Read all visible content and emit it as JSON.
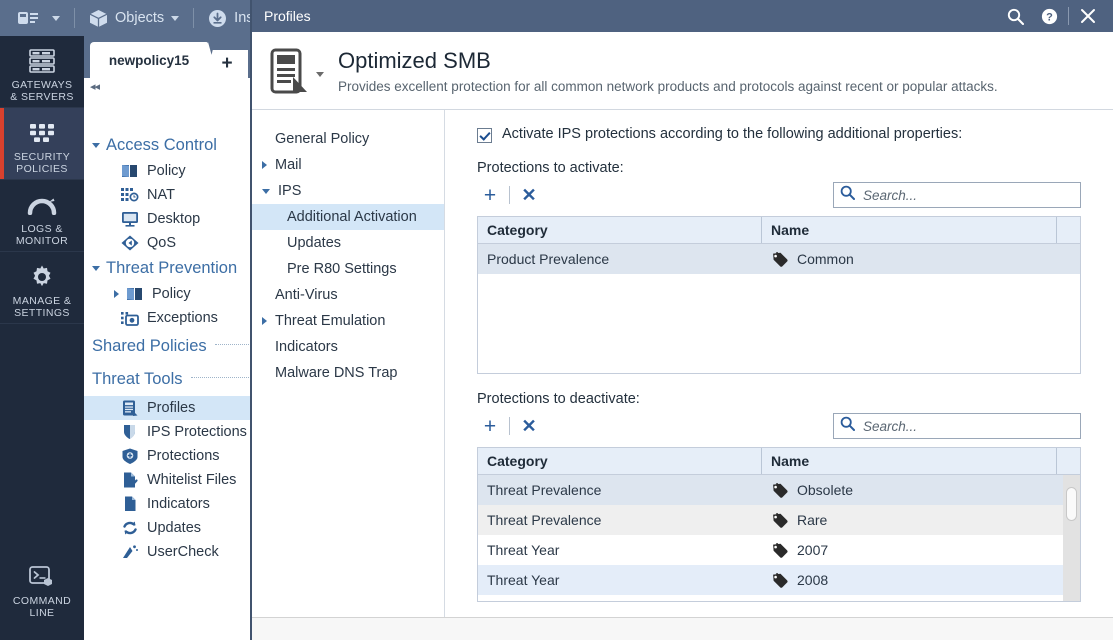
{
  "app": {
    "toolbar": {
      "menu_icon": "app-menu-icon",
      "items": [
        {
          "label": "Objects",
          "icon": "cube-icon",
          "has_caret": true
        },
        {
          "label": "Insta",
          "icon": "install-policy-icon",
          "has_caret": false
        }
      ]
    },
    "rail": {
      "items": [
        {
          "label": "GATEWAYS\n& SERVERS",
          "line1": "GATEWAYS",
          "line2": "& SERVERS",
          "icon": "servers-icon",
          "selected": false
        },
        {
          "label": "SECURITY POLICIES",
          "line1": "SECURITY",
          "line2": "POLICIES",
          "icon": "grid-blocks-icon",
          "selected": true
        },
        {
          "label": "LOGS & MONITOR",
          "line1": "LOGS &",
          "line2": "MONITOR",
          "icon": "gauge-icon",
          "selected": false
        },
        {
          "label": "MANAGE & SETTINGS",
          "line1": "MANAGE &",
          "line2": "SETTINGS",
          "icon": "gear-icon",
          "selected": false
        }
      ],
      "bottom": {
        "line1": "COMMAND",
        "line2": "LINE",
        "icon": "command-line-icon"
      }
    },
    "tab": {
      "label": "newpolicy15",
      "add_label": "+",
      "collapse_label": "◂◂"
    },
    "tree": {
      "groups": [
        {
          "label": "Access Control",
          "expanded": true,
          "items": [
            {
              "label": "Policy",
              "icon": "policy-book-icon",
              "expandable": false
            },
            {
              "label": "NAT",
              "icon": "nat-icon",
              "expandable": false
            },
            {
              "label": "Desktop",
              "icon": "desktop-icon",
              "expandable": false
            },
            {
              "label": "QoS",
              "icon": "qos-icon",
              "expandable": false
            }
          ]
        },
        {
          "label": "Threat Prevention",
          "expanded": true,
          "items": [
            {
              "label": "Policy",
              "icon": "policy-book-icon",
              "expandable": true
            },
            {
              "label": "Exceptions",
              "icon": "exceptions-icon",
              "expandable": false
            }
          ]
        }
      ],
      "shared_policies_label": "Shared Policies",
      "threat_tools_label": "Threat Tools",
      "threat_tools": [
        {
          "label": "Profiles",
          "icon": "profiles-icon",
          "selected": true
        },
        {
          "label": "IPS Protections",
          "icon": "ips-shield-icon",
          "selected": false
        },
        {
          "label": "Protections",
          "icon": "protections-badge-icon",
          "selected": false
        },
        {
          "label": "Whitelist Files",
          "icon": "whitelist-files-icon",
          "selected": false
        },
        {
          "label": "Indicators",
          "icon": "indicators-doc-icon",
          "selected": false
        },
        {
          "label": "Updates",
          "icon": "updates-refresh-icon",
          "selected": false
        },
        {
          "label": "UserCheck",
          "icon": "usercheck-icon",
          "selected": false
        }
      ]
    }
  },
  "dialog": {
    "window_title": "Profiles",
    "title_actions": [
      {
        "name": "search-icon",
        "label": "⌕"
      },
      {
        "name": "help-icon",
        "label": "?"
      },
      {
        "name": "close-icon",
        "label": "✕"
      }
    ],
    "header": {
      "icon": "profile-document-icon",
      "title": "Optimized SMB",
      "subtitle": "Provides excellent protection for all common network products and protocols against recent or popular attacks."
    },
    "nav": [
      {
        "label": "General Policy",
        "level": 0,
        "toggle": "none",
        "selected": false
      },
      {
        "label": "Mail",
        "level": 0,
        "toggle": "right",
        "selected": false
      },
      {
        "label": "IPS",
        "level": 0,
        "toggle": "down",
        "selected": false
      },
      {
        "label": "Additional Activation",
        "level": 1,
        "toggle": "none",
        "selected": true
      },
      {
        "label": "Updates",
        "level": 1,
        "toggle": "none",
        "selected": false
      },
      {
        "label": "Pre R80 Settings",
        "level": 1,
        "toggle": "none",
        "selected": false
      },
      {
        "label": "Anti-Virus",
        "level": 0,
        "toggle": "none",
        "selected": false
      },
      {
        "label": "Threat Emulation",
        "level": 0,
        "toggle": "right",
        "selected": false
      },
      {
        "label": "Indicators",
        "level": 0,
        "toggle": "none",
        "selected": false
      },
      {
        "label": "Malware DNS Trap",
        "level": 0,
        "toggle": "none",
        "selected": false
      }
    ],
    "main": {
      "activate_checkbox": {
        "label": "Activate IPS protections according to the following additional properties:",
        "checked": true
      },
      "activate_section": {
        "label": "Protections to activate:",
        "add_label": "+",
        "remove_label": "✕",
        "search_placeholder": "Search...",
        "search_value": "",
        "columns": [
          "Category",
          "Name"
        ],
        "rows": [
          {
            "category": "Product Prevalence",
            "name": "Common",
            "icon": "tag-icon"
          }
        ],
        "has_scrollbar": false
      },
      "deactivate_section": {
        "label": "Protections to deactivate:",
        "add_label": "+",
        "remove_label": "✕",
        "search_placeholder": "Search...",
        "search_value": "",
        "columns": [
          "Category",
          "Name"
        ],
        "rows": [
          {
            "category": "Threat Prevalence",
            "name": "Obsolete",
            "icon": "tag-icon"
          },
          {
            "category": "Threat Prevalence",
            "name": "Rare",
            "icon": "tag-icon"
          },
          {
            "category": "Threat Year",
            "name": "2007",
            "icon": "tag-icon"
          },
          {
            "category": "Threat Year",
            "name": "2008",
            "icon": "tag-icon"
          }
        ],
        "has_scrollbar": true
      }
    }
  },
  "colors": {
    "toolbar_bg": "#5a6e8c",
    "rail_bg": "#1f2a3c",
    "rail_selected_bg": "#34405a",
    "rail_accent": "#d9412e",
    "dialog_titlebar": "#4f6280",
    "link_blue": "#3c6ea5",
    "selection_blue": "#d3e6f7",
    "grid_header": "#e6eef8"
  }
}
